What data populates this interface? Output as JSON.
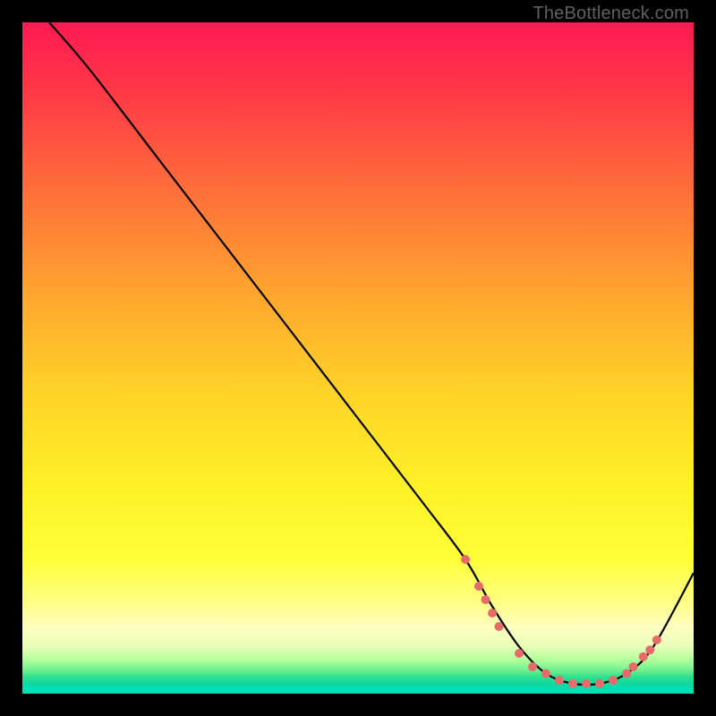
{
  "watermark": "TheBottleneck.com",
  "chart_data": {
    "type": "line",
    "title": "",
    "xlabel": "",
    "ylabel": "",
    "xlim": [
      0,
      100
    ],
    "ylim": [
      0,
      100
    ],
    "background_gradient": {
      "stops": [
        {
          "pos": 0.0,
          "color": "#ff1a52"
        },
        {
          "pos": 0.1,
          "color": "#ff3747"
        },
        {
          "pos": 0.25,
          "color": "#ff6e3a"
        },
        {
          "pos": 0.4,
          "color": "#ffa42f"
        },
        {
          "pos": 0.55,
          "color": "#ffd328"
        },
        {
          "pos": 0.7,
          "color": "#fff228"
        },
        {
          "pos": 0.8,
          "color": "#ffff3a"
        },
        {
          "pos": 0.86,
          "color": "#ffff80"
        },
        {
          "pos": 0.9,
          "color": "#ffffc0"
        },
        {
          "pos": 0.93,
          "color": "#e8ffb8"
        },
        {
          "pos": 0.95,
          "color": "#b0ff9a"
        },
        {
          "pos": 0.965,
          "color": "#70f090"
        },
        {
          "pos": 0.975,
          "color": "#30e090"
        },
        {
          "pos": 0.985,
          "color": "#10d8a0"
        },
        {
          "pos": 1.0,
          "color": "#00e0c0"
        }
      ]
    },
    "series": [
      {
        "name": "bottleneck-curve",
        "color": "#000000",
        "x": [
          4,
          10,
          20,
          30,
          40,
          50,
          60,
          66,
          70,
          74,
          78,
          82,
          86,
          90,
          94,
          100
        ],
        "y": [
          100,
          93,
          80,
          67,
          54,
          41,
          28,
          20,
          13,
          7,
          3,
          1.5,
          1.5,
          3,
          7,
          18
        ]
      }
    ],
    "markers": {
      "name": "highlight-dots",
      "color": "#e86b6b",
      "radius": 5,
      "points": [
        {
          "x": 66,
          "y": 20
        },
        {
          "x": 68,
          "y": 16
        },
        {
          "x": 69,
          "y": 14
        },
        {
          "x": 70,
          "y": 12
        },
        {
          "x": 71,
          "y": 10
        },
        {
          "x": 74,
          "y": 6
        },
        {
          "x": 76,
          "y": 4
        },
        {
          "x": 78,
          "y": 3
        },
        {
          "x": 80,
          "y": 2
        },
        {
          "x": 82,
          "y": 1.5
        },
        {
          "x": 84,
          "y": 1.5
        },
        {
          "x": 86,
          "y": 1.5
        },
        {
          "x": 88,
          "y": 2
        },
        {
          "x": 90,
          "y": 3
        },
        {
          "x": 91,
          "y": 4
        },
        {
          "x": 92.5,
          "y": 5.5
        },
        {
          "x": 93.5,
          "y": 6.5
        },
        {
          "x": 94.5,
          "y": 8
        }
      ]
    }
  }
}
